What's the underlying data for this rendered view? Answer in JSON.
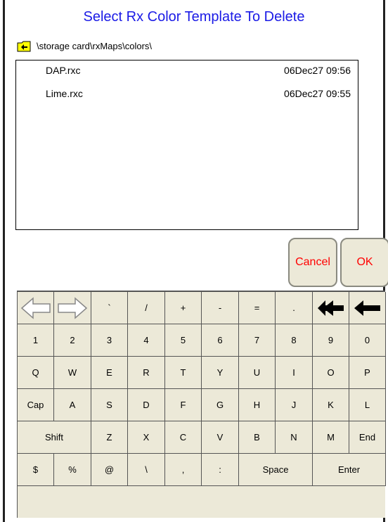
{
  "title": "Select Rx Color Template To Delete",
  "path": "\\storage card\\rxMaps\\colors\\",
  "files": [
    {
      "name": "DAP.rxc",
      "date": "06Dec27 09:56"
    },
    {
      "name": "Lime.rxc",
      "date": "06Dec27 09:55"
    }
  ],
  "buttons": {
    "cancel": "Cancel",
    "ok": "OK"
  },
  "colors": {
    "title": "#1a1ae6",
    "action_text": "#ff0000",
    "key_bg": "#ece9d8"
  },
  "keyboard": {
    "row1": [
      "left-outline-arrow-icon",
      "right-outline-arrow-icon",
      "`",
      "/",
      "+",
      "-",
      "=",
      ".",
      "double-left-arrow-icon",
      "left-arrow-icon"
    ],
    "row2": [
      "1",
      "2",
      "3",
      "4",
      "5",
      "6",
      "7",
      "8",
      "9",
      "0"
    ],
    "row3": [
      "Q",
      "W",
      "E",
      "R",
      "T",
      "Y",
      "U",
      "I",
      "O",
      "P"
    ],
    "row4": [
      "Cap",
      "A",
      "S",
      "D",
      "F",
      "G",
      "H",
      "J",
      "K",
      "L"
    ],
    "row5": [
      "Shift",
      "Z",
      "X",
      "C",
      "V",
      "B",
      "N",
      "M",
      "End"
    ],
    "row6": [
      "$",
      "%",
      "@",
      "\\",
      ",",
      ":",
      "Space",
      "Enter"
    ]
  }
}
